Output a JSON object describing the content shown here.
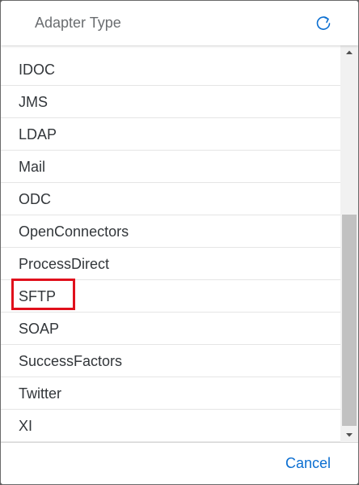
{
  "dialog": {
    "title": "Adapter Type",
    "refresh_icon": "refresh-icon",
    "items": [
      {
        "label": "IDOC"
      },
      {
        "label": "JMS"
      },
      {
        "label": "LDAP"
      },
      {
        "label": "Mail"
      },
      {
        "label": "ODC"
      },
      {
        "label": "OpenConnectors"
      },
      {
        "label": "ProcessDirect"
      },
      {
        "label": "SFTP"
      },
      {
        "label": "SOAP"
      },
      {
        "label": "SuccessFactors"
      },
      {
        "label": "Twitter"
      },
      {
        "label": "XI"
      }
    ],
    "cancel_label": "Cancel"
  },
  "colors": {
    "accent": "#0a6ed1",
    "highlight": "#e0101c",
    "text": "#32363a",
    "title": "#6a6d70"
  }
}
